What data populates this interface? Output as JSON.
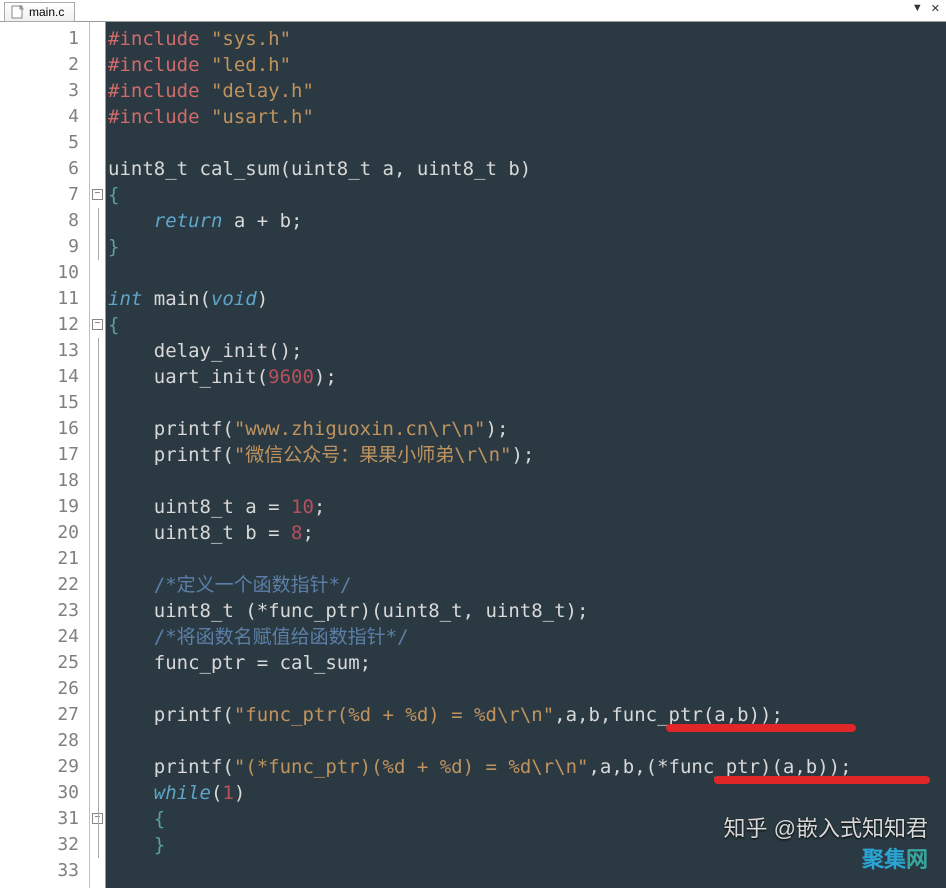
{
  "tab": {
    "filename": "main.c"
  },
  "tab_controls": {
    "dropdown": "▼",
    "close": "✕"
  },
  "code": {
    "l1": {
      "pre": "#include ",
      "str": "\"sys.h\""
    },
    "l2": {
      "pre": "#include ",
      "str": "\"led.h\""
    },
    "l3": {
      "pre": "#include ",
      "str": "\"delay.h\""
    },
    "l4": {
      "pre": "#include ",
      "str": "\"usart.h\""
    },
    "l6": {
      "a": "uint8_t cal_sum(uint8_t a, uint8_t b)"
    },
    "l7": {
      "a": "{"
    },
    "l8": {
      "kw": "return",
      "a": " a + b;"
    },
    "l9": {
      "a": "}"
    },
    "l11": {
      "kw": "int",
      "a": " main(",
      "kw2": "void",
      "b": ")"
    },
    "l12": {
      "a": "{"
    },
    "l13": {
      "a": "    delay_init();"
    },
    "l14": {
      "a": "    uart_init(",
      "num": "9600",
      "b": ");"
    },
    "l16": {
      "a": "    printf(",
      "str": "\"www.zhiguoxin.cn\\r\\n\"",
      "b": ");"
    },
    "l17": {
      "a": "    printf(",
      "str": "\"微信公众号：果果小师弟\\r\\n\"",
      "b": ");"
    },
    "l19": {
      "a": "    uint8_t a = ",
      "num": "10",
      "b": ";"
    },
    "l20": {
      "a": "    uint8_t b = ",
      "num": "8",
      "b": ";"
    },
    "l22": {
      "c": "    /*定义一个函数指针*/"
    },
    "l23": {
      "a": "    uint8_t (*func_ptr)(uint8_t, uint8_t);"
    },
    "l24": {
      "c": "    /*将函数名赋值给函数指针*/"
    },
    "l25": {
      "a": "    func_ptr = cal_sum;"
    },
    "l27": {
      "a": "    printf(",
      "str": "\"func_ptr(%d + %d) = %d\\r\\n\"",
      "b": ",a,b,func_ptr(a,b));"
    },
    "l29": {
      "a": "    printf(",
      "str": "\"(*func_ptr)(%d + %d) = %d\\r\\n\"",
      "b": ",a,b,(*func_ptr)(a,b));"
    },
    "l30": {
      "kw": "while",
      "a": "(",
      "num": "1",
      "b": ")"
    },
    "l31": {
      "a": "    {"
    },
    "l32": {
      "a": "    }"
    }
  },
  "line_numbers": [
    "1",
    "2",
    "3",
    "4",
    "5",
    "6",
    "7",
    "8",
    "9",
    "10",
    "11",
    "12",
    "13",
    "14",
    "15",
    "16",
    "17",
    "18",
    "19",
    "20",
    "21",
    "22",
    "23",
    "24",
    "25",
    "26",
    "27",
    "28",
    "29",
    "30",
    "31",
    "32",
    "33"
  ],
  "watermark": {
    "zhihu": "知乎 @嵌入式知知君",
    "site": "聚集网"
  }
}
